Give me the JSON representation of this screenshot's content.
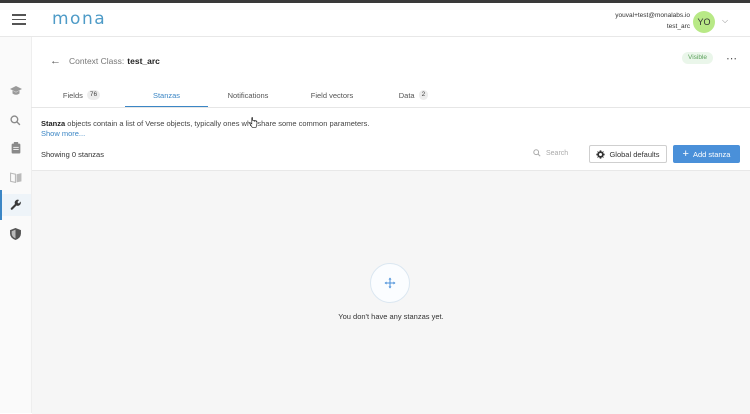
{
  "app": {
    "logo": "mona"
  },
  "user": {
    "email": "youval+test@monalabs.io",
    "workspace": "test_arc",
    "initials": "YO"
  },
  "sidebar": {
    "items": [
      {
        "name": "learn",
        "icon": "graduation-cap-icon"
      },
      {
        "name": "search",
        "icon": "search-icon"
      },
      {
        "name": "reports",
        "icon": "clipboard-icon"
      },
      {
        "name": "dashboards",
        "icon": "book-icon"
      },
      {
        "name": "configuration",
        "icon": "wrench-icon",
        "active": true
      },
      {
        "name": "security",
        "icon": "shield-icon"
      }
    ]
  },
  "header": {
    "context_label": "Context Class:",
    "context_name": "test_arc",
    "status_badge": "Visible"
  },
  "tabs": [
    {
      "label": "Fields",
      "count": "76"
    },
    {
      "label": "Stanzas",
      "active": true
    },
    {
      "label": "Notifications"
    },
    {
      "label": "Field vectors"
    },
    {
      "label": "Data",
      "count": "2"
    }
  ],
  "content": {
    "desc_strong": "Stanza",
    "desc_rest": " objects contain a list of Verse objects, typically ones who share some common parameters.",
    "show_more": "Show more...",
    "showing": "Showing 0 stanzas",
    "search_placeholder": "Search",
    "global_defaults_label": "Global defaults",
    "add_stanza_label": "Add stanza",
    "empty_message": "You don't have any stanzas yet."
  },
  "colors": {
    "accent": "#3b86c5",
    "primary_button": "#4a90d9",
    "badge_green": "#5aa05a",
    "avatar": "#b8e986"
  }
}
